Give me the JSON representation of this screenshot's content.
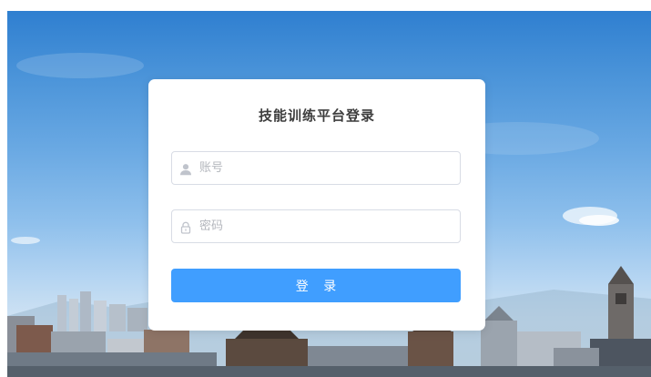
{
  "login": {
    "title": "技能训练平台登录",
    "account_placeholder": "账号",
    "password_placeholder": "密码",
    "submit_label": "登 录"
  },
  "icons": {
    "account": "user-icon",
    "password": "lock-icon"
  },
  "colors": {
    "primary_button": "#409eff",
    "card_background": "#ffffff",
    "title_text": "#3d3d3d",
    "placeholder_text": "#b4b7bd"
  }
}
